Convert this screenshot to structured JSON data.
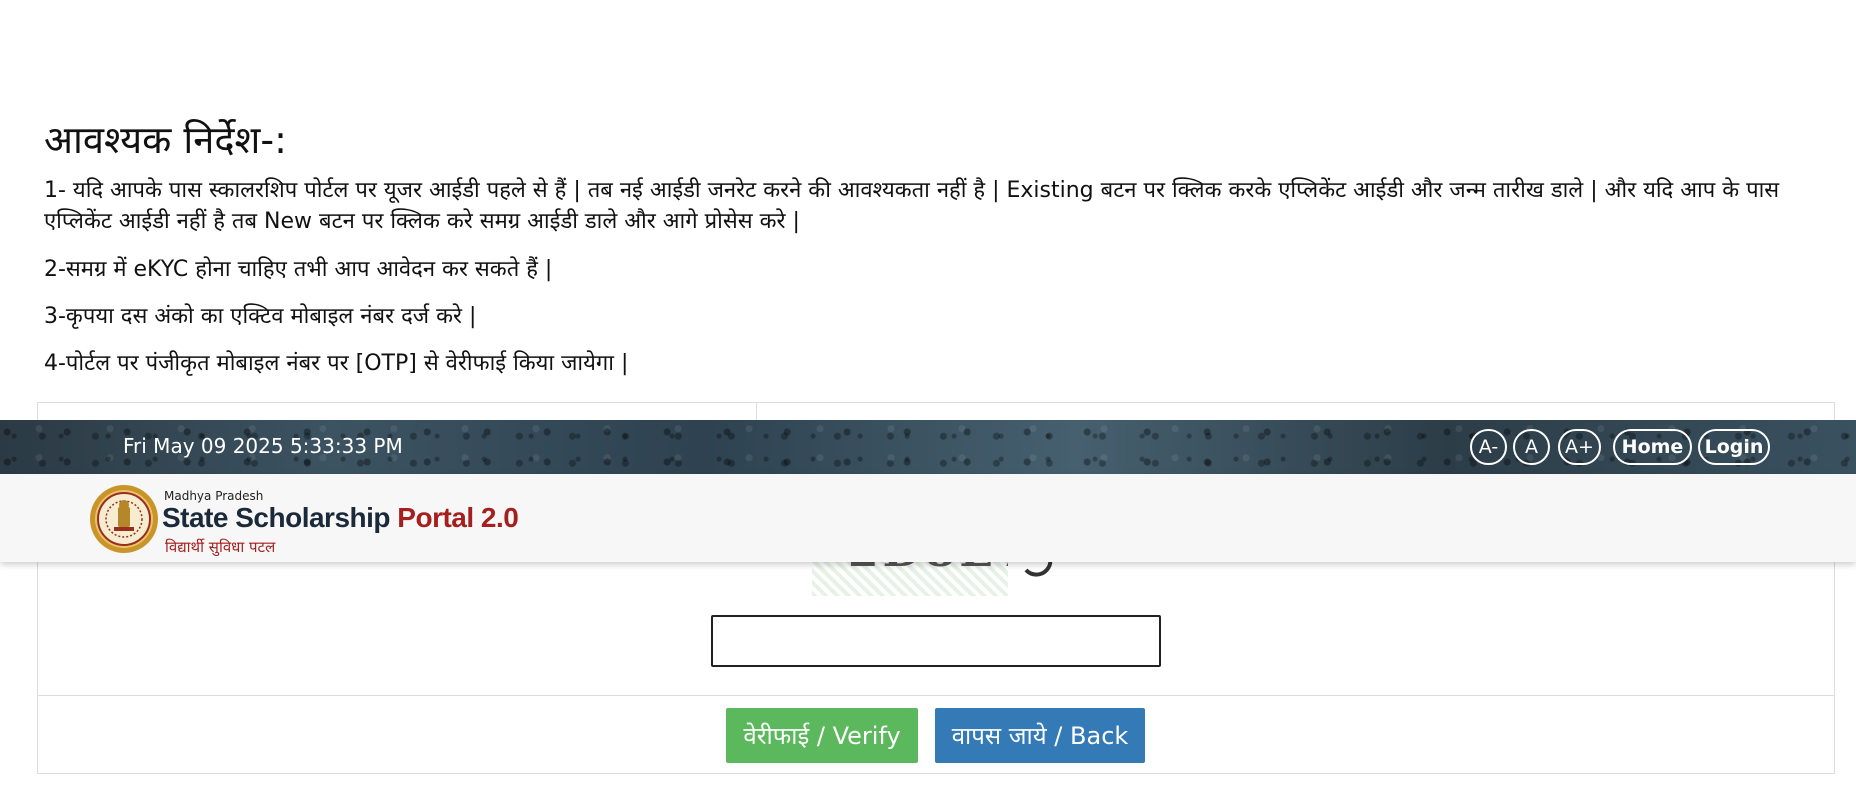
{
  "instructions": {
    "heading": "आवश्यक निर्देश-:",
    "items": [
      "1- यदि आपके पास स्कालरशिप पोर्टल पर यूजर आईडी पहले से हैं | तब नई आईडी जनरेट करने की आवश्यकता नहीं है | Existing बटन पर क्लिक करके एप्लिकेंट आईडी और जन्म तारीख डाले | और यदि आप के पास एप्लिकेंट आईडी नहीं है तब New बटन पर क्लिक करे समग्र आईडी डाले और आगे प्रोसेस करे |",
      "2-समग्र में eKYC होना चाहिए तभी आप आवेदन कर सकते हैं |",
      "3-कृपया दस अंको का एक्टिव मोबाइल नंबर दर्ज करे |",
      "4-पोर्टल पर पंजीकृत मोबाइल नंबर पर [OTP] से वेरीफाई किया जायेगा |"
    ]
  },
  "header": {
    "datetime": "Fri May 09 2025 5:33:33 PM",
    "font_buttons": [
      "A-",
      "A",
      "A+"
    ],
    "home_label": "Home",
    "login_label": "Login"
  },
  "brand": {
    "state": "Madhya Pradesh",
    "title_main": "State Scholarship ",
    "title_accent": "Portal 2.0",
    "tagline": "विद्यार्थी सुविधा पटल"
  },
  "form": {
    "captcha_text": "2D8E7C",
    "verify_label": "वेरीफाई / Verify",
    "back_label": "वापस जाये / Back"
  },
  "colors": {
    "verify_button": "#5cb85c",
    "back_button": "#337ab7",
    "brand_accent": "#a51f1f"
  }
}
